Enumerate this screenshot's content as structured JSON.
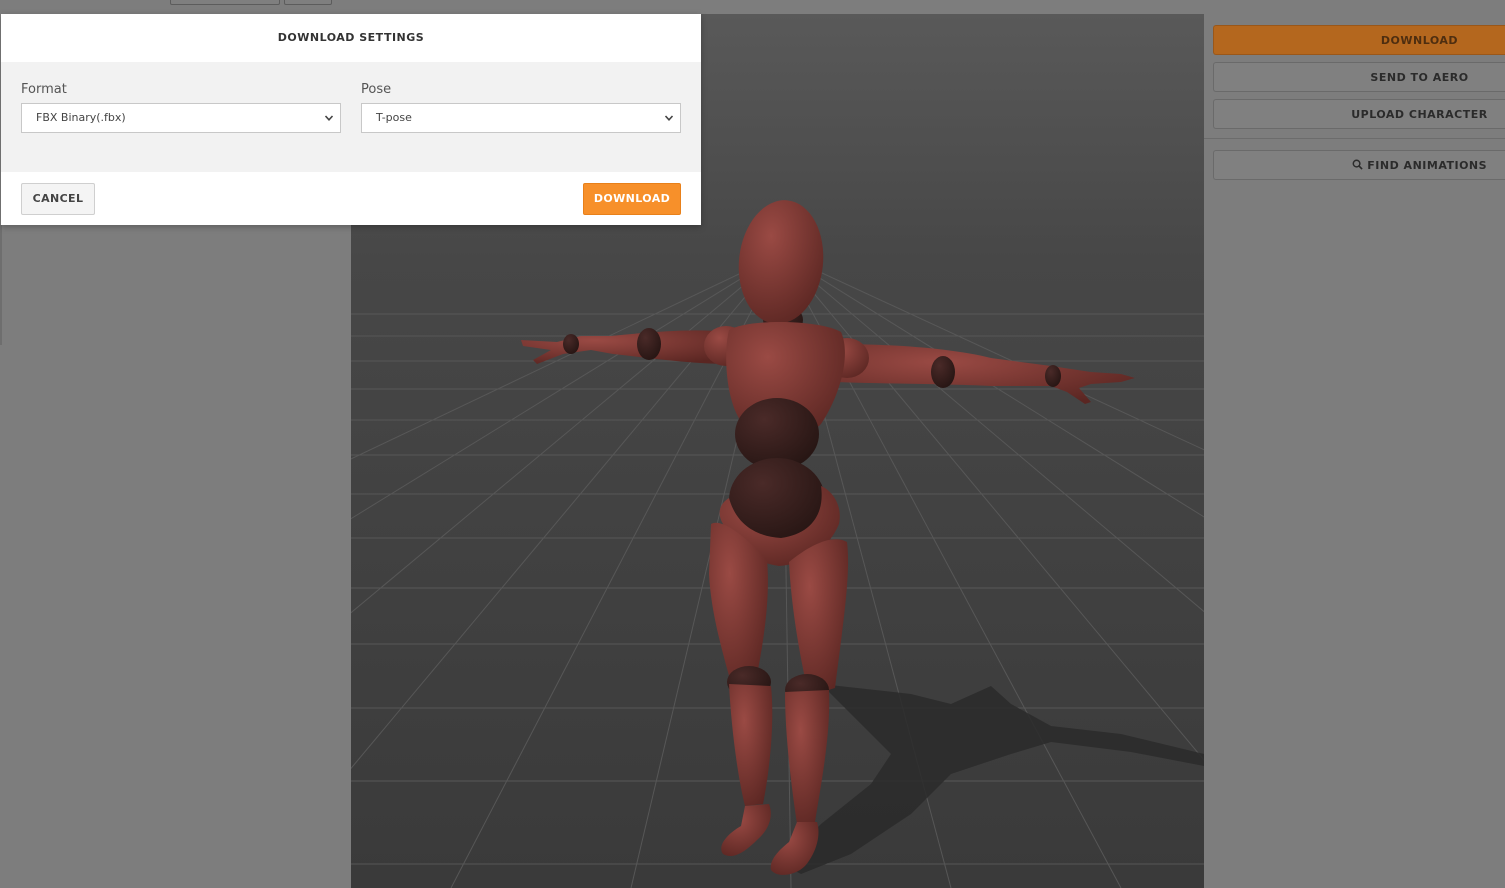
{
  "modal": {
    "title": "DOWNLOAD SETTINGS",
    "format": {
      "label": "Format",
      "value": "FBX Binary(.fbx)"
    },
    "pose": {
      "label": "Pose",
      "value": "T-pose"
    },
    "cancel_label": "CANCEL",
    "download_label": "DOWNLOAD"
  },
  "right_panel": {
    "download_label": "DOWNLOAD",
    "send_to_aero_label": "SEND TO AERO",
    "upload_character_label": "UPLOAD CHARACTER",
    "find_animations_label": "FIND ANIMATIONS"
  },
  "colors": {
    "accent": "#f7902a",
    "character": "#7a3530",
    "floor": "#3f3f3f"
  },
  "icons": {
    "select_arrow": "chevron-down-icon",
    "search": "search-icon"
  }
}
